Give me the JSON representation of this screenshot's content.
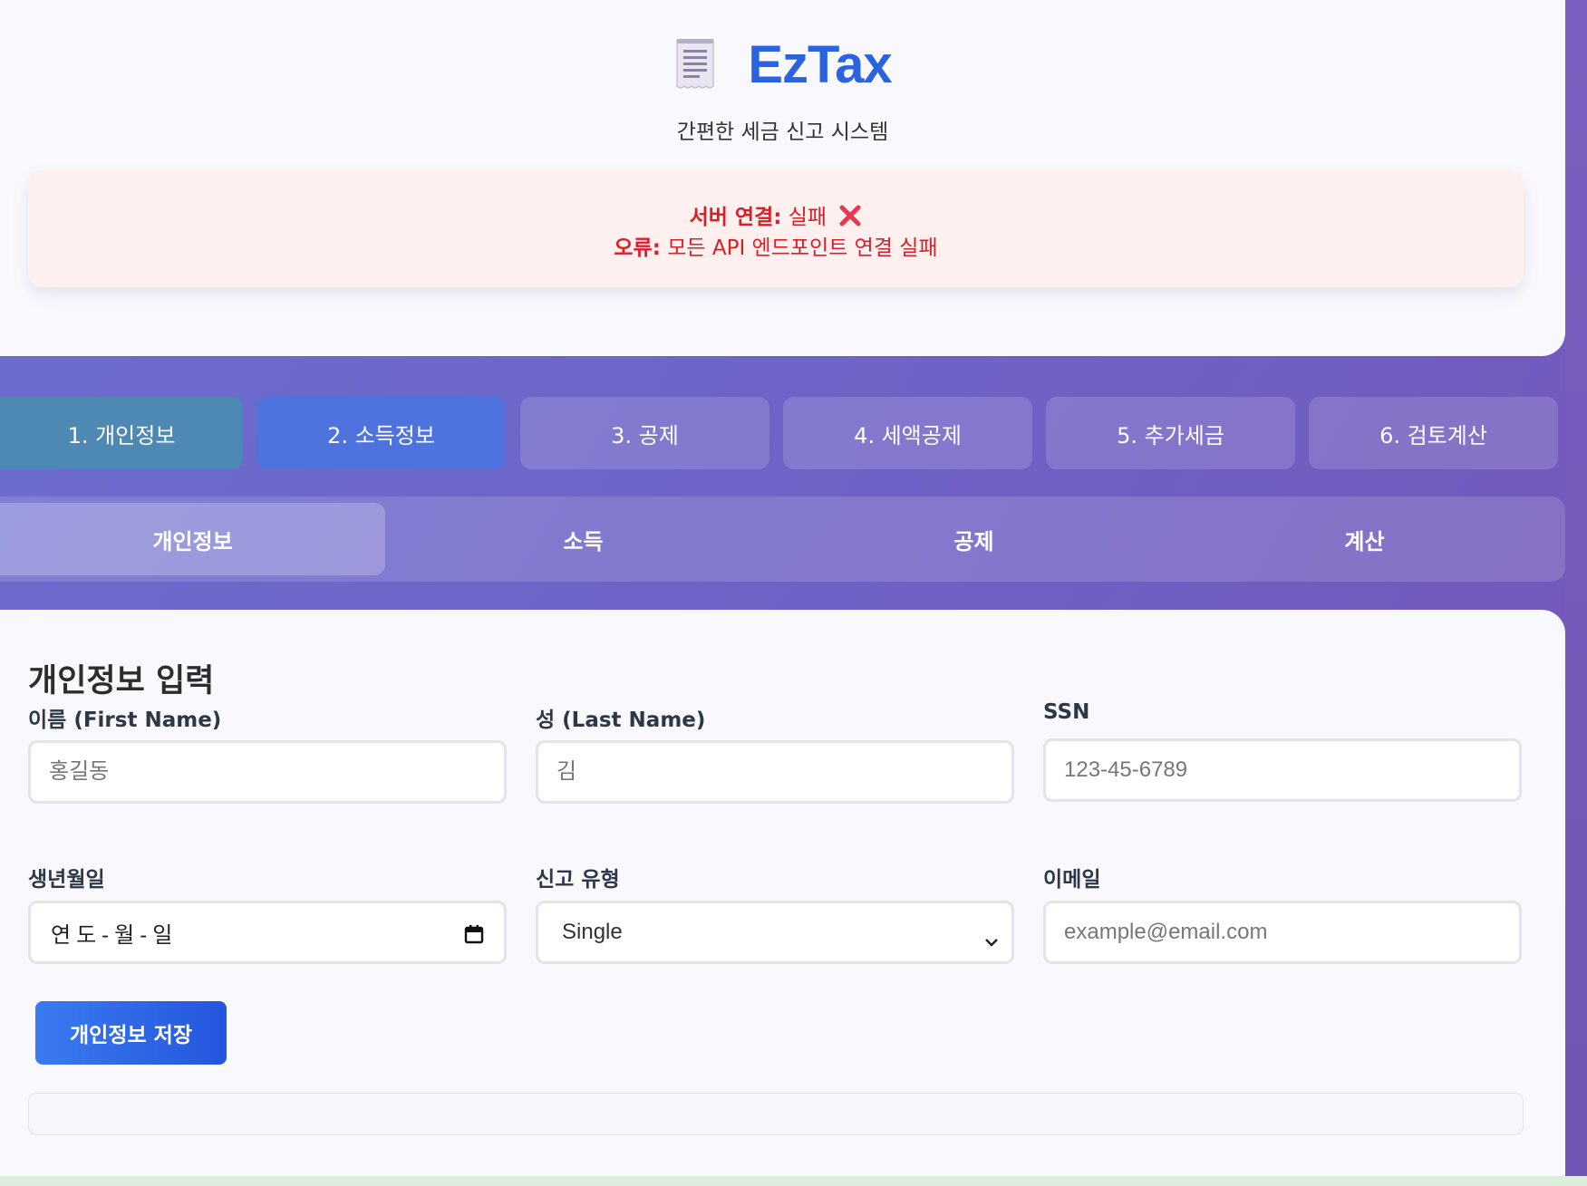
{
  "app": {
    "brand_title": "EzTax",
    "subtitle": "간편한 세금 신고 시스템",
    "logo_icon": "receipt-icon"
  },
  "alert": {
    "server_label": "서버 연결:",
    "server_value": "실패",
    "error_label": "오류:",
    "error_value": "모든 API 엔드포인트 연결 실패",
    "status_icon": "cross-mark-icon",
    "color": "#d91f26"
  },
  "steps": [
    {
      "label": "1. 개인정보",
      "state": "done"
    },
    {
      "label": "2. 소득정보",
      "state": "active"
    },
    {
      "label": "3. 공제",
      "state": "pending"
    },
    {
      "label": "4. 세액공제",
      "state": "pending"
    },
    {
      "label": "5. 추가세금",
      "state": "pending"
    },
    {
      "label": "6. 검토계산",
      "state": "pending"
    }
  ],
  "subtabs": [
    {
      "label": "개인정보",
      "active": true
    },
    {
      "label": "소득",
      "active": false
    },
    {
      "label": "공제",
      "active": false
    },
    {
      "label": "계산",
      "active": false
    }
  ],
  "form": {
    "title": "개인정보 입력",
    "first_name": {
      "label": "이름 (First Name)",
      "placeholder": "홍길동"
    },
    "last_name": {
      "label": "성 (Last Name)",
      "placeholder": "김"
    },
    "ssn": {
      "label": "SSN",
      "placeholder": "123-45-6789"
    },
    "birthdate": {
      "label": "생년월일",
      "value": "연도-월-일"
    },
    "filing_type": {
      "label": "신고 유형",
      "value": "Single"
    },
    "email": {
      "label": "이메일",
      "placeholder": "example@email.com"
    },
    "save_label": "개인정보 저장"
  },
  "colors": {
    "brand": "#2a63e0",
    "step_done": "#4d89b2",
    "step_active": "#4e73de",
    "button": "#2c63e6"
  }
}
